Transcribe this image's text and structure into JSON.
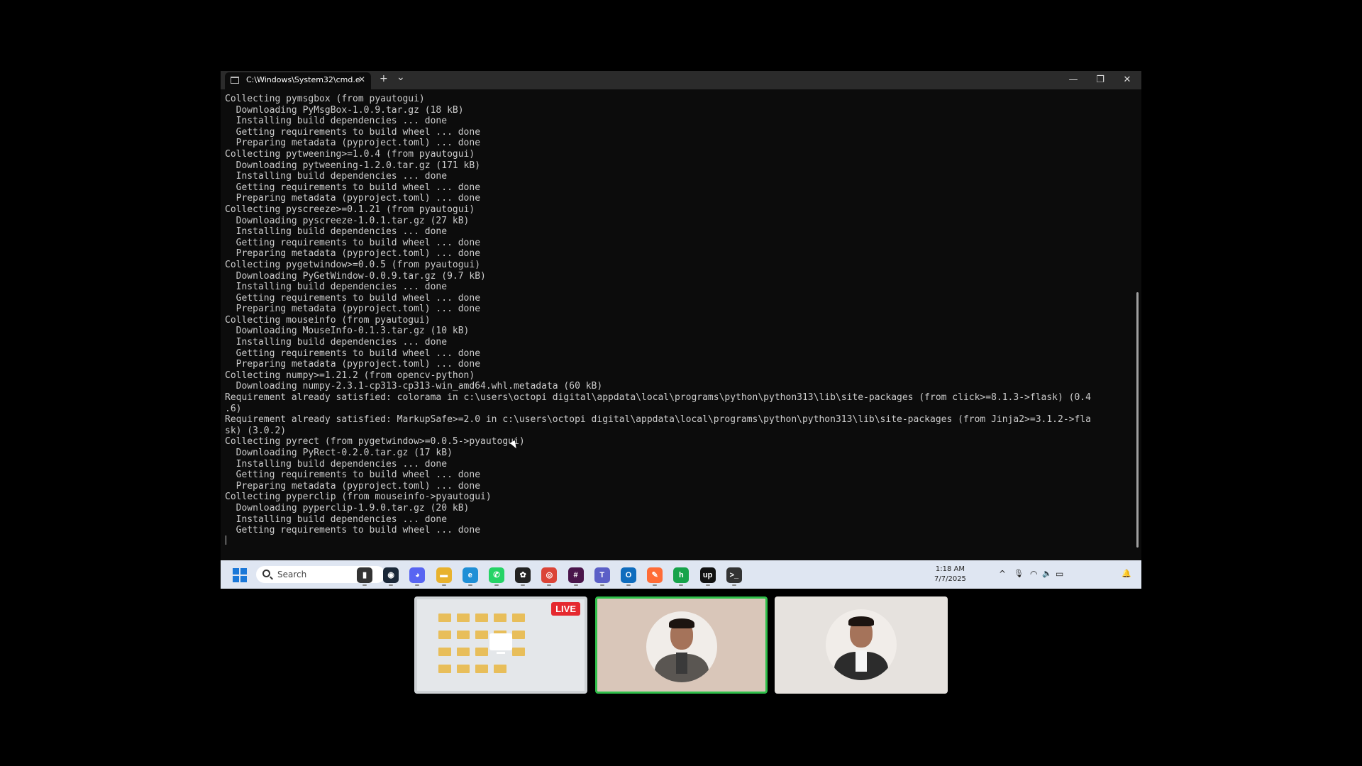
{
  "terminal": {
    "tab_title": "C:\\Windows\\System32\\cmd.e",
    "new_tab_symbol": "+",
    "dropdown_symbol": "⌄",
    "tab_close_symbol": "✕",
    "minimize_symbol": "—",
    "restore_symbol": "❐",
    "close_symbol": "✕",
    "lines": [
      "Collecting pymsgbox (from pyautogui)",
      "  Downloading PyMsgBox-1.0.9.tar.gz (18 kB)",
      "  Installing build dependencies ... done",
      "  Getting requirements to build wheel ... done",
      "  Preparing metadata (pyproject.toml) ... done",
      "Collecting pytweening>=1.0.4 (from pyautogui)",
      "  Downloading pytweening-1.2.0.tar.gz (171 kB)",
      "  Installing build dependencies ... done",
      "  Getting requirements to build wheel ... done",
      "  Preparing metadata (pyproject.toml) ... done",
      "Collecting pyscreeze>=0.1.21 (from pyautogui)",
      "  Downloading pyscreeze-1.0.1.tar.gz (27 kB)",
      "  Installing build dependencies ... done",
      "  Getting requirements to build wheel ... done",
      "  Preparing metadata (pyproject.toml) ... done",
      "Collecting pygetwindow>=0.0.5 (from pyautogui)",
      "  Downloading PyGetWindow-0.0.9.tar.gz (9.7 kB)",
      "  Installing build dependencies ... done",
      "  Getting requirements to build wheel ... done",
      "  Preparing metadata (pyproject.toml) ... done",
      "Collecting mouseinfo (from pyautogui)",
      "  Downloading MouseInfo-0.1.3.tar.gz (10 kB)",
      "  Installing build dependencies ... done",
      "  Getting requirements to build wheel ... done",
      "  Preparing metadata (pyproject.toml) ... done",
      "Collecting numpy>=1.21.2 (from opencv-python)",
      "  Downloading numpy-2.3.1-cp313-cp313-win_amd64.whl.metadata (60 kB)",
      "Requirement already satisfied: colorama in c:\\users\\octopi digital\\appdata\\local\\programs\\python\\python313\\lib\\site-packages (from click>=8.1.3->flask) (0.4",
      ".6)",
      "Requirement already satisfied: MarkupSafe>=2.0 in c:\\users\\octopi digital\\appdata\\local\\programs\\python\\python313\\lib\\site-packages (from Jinja2>=3.1.2->fla",
      "sk) (3.0.2)",
      "Collecting pyrect (from pygetwindow>=0.0.5->pyautogui)",
      "  Downloading PyRect-0.2.0.tar.gz (17 kB)",
      "  Installing build dependencies ... done",
      "  Getting requirements to build wheel ... done",
      "  Preparing metadata (pyproject.toml) ... done",
      "Collecting pyperclip (from mouseinfo->pyautogui)",
      "  Downloading pyperclip-1.9.0.tar.gz (20 kB)",
      "  Installing build dependencies ... done",
      "  Getting requirements to build wheel ... done"
    ]
  },
  "taskbar": {
    "search_placeholder": "Search",
    "time": "1:18 AM",
    "date": "7/7/2025",
    "apps": [
      {
        "name": "task-view",
        "glyph": "▮",
        "color": "#333333"
      },
      {
        "name": "steam",
        "glyph": "◉",
        "color": "#1b2838"
      },
      {
        "name": "discord",
        "glyph": "◕",
        "color": "#5865f2"
      },
      {
        "name": "file-explorer",
        "glyph": "▬",
        "color": "#e8b22e"
      },
      {
        "name": "edge",
        "glyph": "e",
        "color": "#1f8fd6"
      },
      {
        "name": "whatsapp",
        "glyph": "✆",
        "color": "#25d366"
      },
      {
        "name": "chatgpt",
        "glyph": "✿",
        "color": "#222222"
      },
      {
        "name": "chrome",
        "glyph": "◎",
        "color": "#db4437"
      },
      {
        "name": "slack",
        "glyph": "#",
        "color": "#4a154b"
      },
      {
        "name": "teams",
        "glyph": "T",
        "color": "#5b5fc7"
      },
      {
        "name": "outlook",
        "glyph": "O",
        "color": "#0f6cbd"
      },
      {
        "name": "postman",
        "glyph": "✎",
        "color": "#ff6c37"
      },
      {
        "name": "shop",
        "glyph": "h",
        "color": "#16a34a"
      },
      {
        "name": "upwork",
        "glyph": "up",
        "color": "#111111"
      },
      {
        "name": "terminal",
        "glyph": ">_",
        "color": "#333333"
      }
    ],
    "tray": {
      "chevron": "^",
      "mic": "🎙",
      "wifi": "◠",
      "volume": "🔈",
      "battery": "▭",
      "bell": "🔔"
    }
  },
  "call": {
    "live_badge": "LIVE"
  }
}
